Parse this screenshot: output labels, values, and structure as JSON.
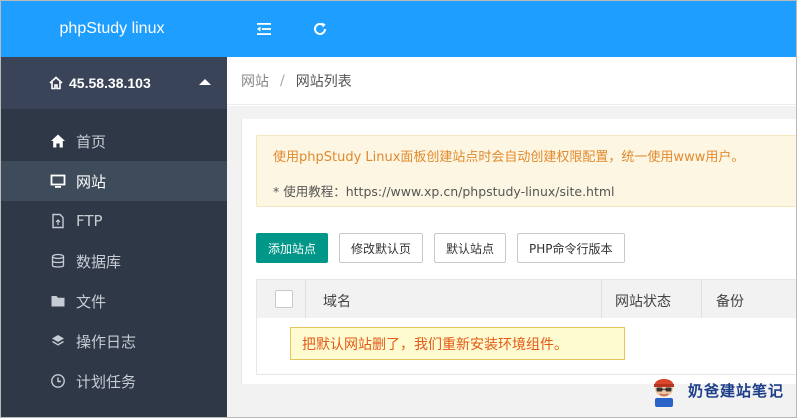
{
  "app": {
    "brand": "phpStudy linux"
  },
  "server": {
    "ip": "45.58.38.103"
  },
  "menu": [
    {
      "label": "首页",
      "icon": "home-icon"
    },
    {
      "label": "网站",
      "icon": "monitor-icon"
    },
    {
      "label": "FTP",
      "icon": "file-icon"
    },
    {
      "label": "数据库",
      "icon": "database-icon"
    },
    {
      "label": "文件",
      "icon": "folder-icon"
    },
    {
      "label": "操作日志",
      "icon": "layers-icon"
    },
    {
      "label": "计划任务",
      "icon": "clock-icon"
    }
  ],
  "breadcrumb": {
    "root": "网站",
    "separator": "/",
    "current": "网站列表"
  },
  "notice": {
    "line1": "使用phpStudy Linux面板创建站点时会自动创建权限配置，统一使用www用户。",
    "line2": "* 使用教程：https://www.xp.cn/phpstudy-linux/site.html"
  },
  "buttons": {
    "add_site": "添加站点",
    "edit_default_page": "修改默认页",
    "default_site": "默认站点",
    "php_cli_version": "PHP命令行版本"
  },
  "table": {
    "headers": [
      "域名",
      "网站状态",
      "备份"
    ]
  },
  "annotation": "把默认网站删了，我们重新安装环境组件。",
  "watermark": "奶爸建站笔记",
  "colors": {
    "brand_blue": "#1e9fff",
    "sidebar_bg": "#2e3846",
    "primary_green": "#009688",
    "notice_text": "#e18a2d"
  }
}
